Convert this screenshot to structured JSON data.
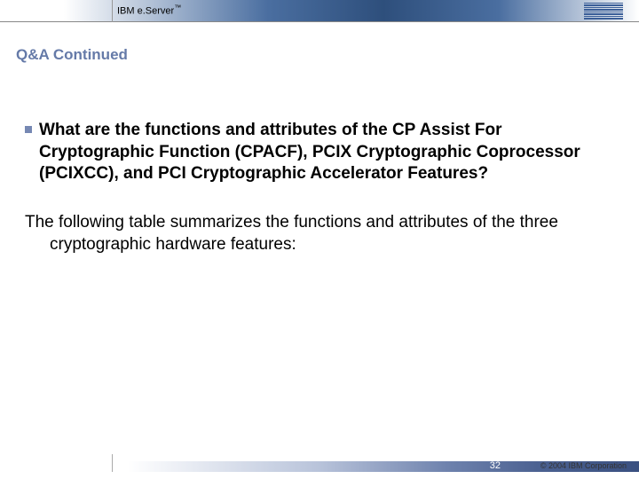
{
  "header": {
    "brand_prefix": "IBM e.",
    "brand_main": "Server",
    "brand_tm": "™"
  },
  "title": "Q&A Continued",
  "bullet": "What are the functions and attributes of the CP Assist For Cryptographic Function (CPACF), PCIX Cryptographic Coprocessor (PCIXCC), and PCI Cryptographic Accelerator Features?",
  "paragraph": "The following table summarizes the functions and attributes of the three cryptographic hardware features:",
  "footer": {
    "page": "32",
    "copyright": "© 2004 IBM Corporation"
  }
}
